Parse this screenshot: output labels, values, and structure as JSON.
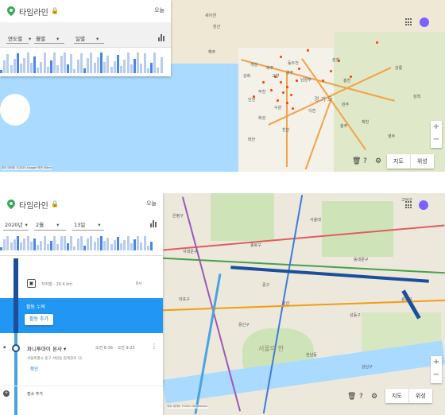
{
  "top": {
    "app_title": "타임라인",
    "today_label": "오늘",
    "selectors": [
      {
        "label": "연도별",
        "caret": "▾"
      },
      {
        "label": "월별",
        "caret": "▾"
      },
      {
        "label": "일별",
        "caret": "▾"
      }
    ],
    "map_labels": [
      "세이센",
      "원산",
      "해주",
      "개성",
      "고양",
      "양주",
      "남양주",
      "부천",
      "수원",
      "화성",
      "강화",
      "인천",
      "파주",
      "동두천",
      "춘천",
      "홍천",
      "강릉",
      "삼척",
      "원주",
      "이천",
      "충주",
      "천안",
      "제천",
      "영주",
      "태안",
      "경기도"
    ],
    "map_type_labels": [
      "지도",
      "위성"
    ],
    "attribution": "지도 데이터 ©2020 Google 약관  50km"
  },
  "bottom": {
    "app_title": "타임라인",
    "today_label": "오늘",
    "selectors": [
      {
        "label": "2020년",
        "caret": "▾"
      },
      {
        "label": "2월",
        "caret": "▾"
      },
      {
        "label": "13일",
        "caret": "▾"
      }
    ],
    "place_row": {
      "label": "지하철 · 20.4 km",
      "small": "8시"
    },
    "activity": {
      "label": "활동 누락",
      "button": "활동 추가"
    },
    "visit": {
      "name": "파니투마이 본사",
      "caret": "▾",
      "time": "오전 8:36 – 오전 9:23",
      "address": "서울특별시 중구 서린동 청계천로 11",
      "confirm": "확인"
    },
    "add_place": "장소 추가",
    "map_labels": [
      "은평구",
      "서대문구",
      "종로구",
      "중구",
      "용산구",
      "성동구",
      "광진구",
      "동대문구",
      "마포구",
      "서울대",
      "서울의 한",
      "고덕구",
      "강남구",
      "한남동",
      "남산"
    ],
    "map_type_labels": [
      "지도",
      "위성"
    ],
    "attribution": "지도 데이터 ©2020 SK telecom"
  }
}
